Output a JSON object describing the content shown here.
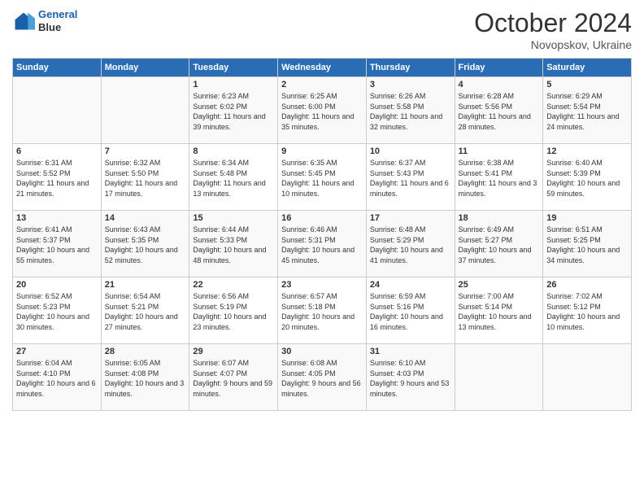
{
  "header": {
    "logo_line1": "General",
    "logo_line2": "Blue",
    "month": "October 2024",
    "location": "Novopskov, Ukraine"
  },
  "weekdays": [
    "Sunday",
    "Monday",
    "Tuesday",
    "Wednesday",
    "Thursday",
    "Friday",
    "Saturday"
  ],
  "weeks": [
    [
      {
        "num": "",
        "info": ""
      },
      {
        "num": "",
        "info": ""
      },
      {
        "num": "1",
        "info": "Sunrise: 6:23 AM\nSunset: 6:02 PM\nDaylight: 11 hours and 39 minutes."
      },
      {
        "num": "2",
        "info": "Sunrise: 6:25 AM\nSunset: 6:00 PM\nDaylight: 11 hours and 35 minutes."
      },
      {
        "num": "3",
        "info": "Sunrise: 6:26 AM\nSunset: 5:58 PM\nDaylight: 11 hours and 32 minutes."
      },
      {
        "num": "4",
        "info": "Sunrise: 6:28 AM\nSunset: 5:56 PM\nDaylight: 11 hours and 28 minutes."
      },
      {
        "num": "5",
        "info": "Sunrise: 6:29 AM\nSunset: 5:54 PM\nDaylight: 11 hours and 24 minutes."
      }
    ],
    [
      {
        "num": "6",
        "info": "Sunrise: 6:31 AM\nSunset: 5:52 PM\nDaylight: 11 hours and 21 minutes."
      },
      {
        "num": "7",
        "info": "Sunrise: 6:32 AM\nSunset: 5:50 PM\nDaylight: 11 hours and 17 minutes."
      },
      {
        "num": "8",
        "info": "Sunrise: 6:34 AM\nSunset: 5:48 PM\nDaylight: 11 hours and 13 minutes."
      },
      {
        "num": "9",
        "info": "Sunrise: 6:35 AM\nSunset: 5:45 PM\nDaylight: 11 hours and 10 minutes."
      },
      {
        "num": "10",
        "info": "Sunrise: 6:37 AM\nSunset: 5:43 PM\nDaylight: 11 hours and 6 minutes."
      },
      {
        "num": "11",
        "info": "Sunrise: 6:38 AM\nSunset: 5:41 PM\nDaylight: 11 hours and 3 minutes."
      },
      {
        "num": "12",
        "info": "Sunrise: 6:40 AM\nSunset: 5:39 PM\nDaylight: 10 hours and 59 minutes."
      }
    ],
    [
      {
        "num": "13",
        "info": "Sunrise: 6:41 AM\nSunset: 5:37 PM\nDaylight: 10 hours and 55 minutes."
      },
      {
        "num": "14",
        "info": "Sunrise: 6:43 AM\nSunset: 5:35 PM\nDaylight: 10 hours and 52 minutes."
      },
      {
        "num": "15",
        "info": "Sunrise: 6:44 AM\nSunset: 5:33 PM\nDaylight: 10 hours and 48 minutes."
      },
      {
        "num": "16",
        "info": "Sunrise: 6:46 AM\nSunset: 5:31 PM\nDaylight: 10 hours and 45 minutes."
      },
      {
        "num": "17",
        "info": "Sunrise: 6:48 AM\nSunset: 5:29 PM\nDaylight: 10 hours and 41 minutes."
      },
      {
        "num": "18",
        "info": "Sunrise: 6:49 AM\nSunset: 5:27 PM\nDaylight: 10 hours and 37 minutes."
      },
      {
        "num": "19",
        "info": "Sunrise: 6:51 AM\nSunset: 5:25 PM\nDaylight: 10 hours and 34 minutes."
      }
    ],
    [
      {
        "num": "20",
        "info": "Sunrise: 6:52 AM\nSunset: 5:23 PM\nDaylight: 10 hours and 30 minutes."
      },
      {
        "num": "21",
        "info": "Sunrise: 6:54 AM\nSunset: 5:21 PM\nDaylight: 10 hours and 27 minutes."
      },
      {
        "num": "22",
        "info": "Sunrise: 6:56 AM\nSunset: 5:19 PM\nDaylight: 10 hours and 23 minutes."
      },
      {
        "num": "23",
        "info": "Sunrise: 6:57 AM\nSunset: 5:18 PM\nDaylight: 10 hours and 20 minutes."
      },
      {
        "num": "24",
        "info": "Sunrise: 6:59 AM\nSunset: 5:16 PM\nDaylight: 10 hours and 16 minutes."
      },
      {
        "num": "25",
        "info": "Sunrise: 7:00 AM\nSunset: 5:14 PM\nDaylight: 10 hours and 13 minutes."
      },
      {
        "num": "26",
        "info": "Sunrise: 7:02 AM\nSunset: 5:12 PM\nDaylight: 10 hours and 10 minutes."
      }
    ],
    [
      {
        "num": "27",
        "info": "Sunrise: 6:04 AM\nSunset: 4:10 PM\nDaylight: 10 hours and 6 minutes."
      },
      {
        "num": "28",
        "info": "Sunrise: 6:05 AM\nSunset: 4:08 PM\nDaylight: 10 hours and 3 minutes."
      },
      {
        "num": "29",
        "info": "Sunrise: 6:07 AM\nSunset: 4:07 PM\nDaylight: 9 hours and 59 minutes."
      },
      {
        "num": "30",
        "info": "Sunrise: 6:08 AM\nSunset: 4:05 PM\nDaylight: 9 hours and 56 minutes."
      },
      {
        "num": "31",
        "info": "Sunrise: 6:10 AM\nSunset: 4:03 PM\nDaylight: 9 hours and 53 minutes."
      },
      {
        "num": "",
        "info": ""
      },
      {
        "num": "",
        "info": ""
      }
    ]
  ]
}
